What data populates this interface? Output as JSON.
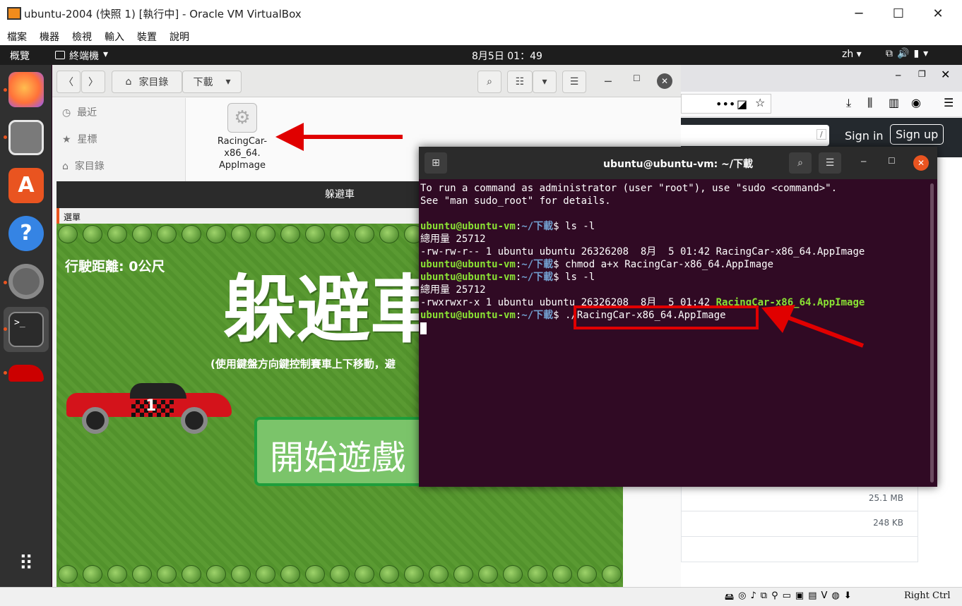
{
  "vbox": {
    "title": "ubuntu-2004 (快照 1) [執行中] - Oracle VM VirtualBox",
    "menu": [
      "檔案",
      "機器",
      "檢視",
      "輸入",
      "裝置",
      "說明"
    ],
    "status_right": "Right Ctrl"
  },
  "topbar": {
    "activities": "概覽",
    "app": "終端機",
    "clock": "8月5日  01：49",
    "lang": "zh"
  },
  "nautilus": {
    "path_home": "家目錄",
    "path_current": "下載",
    "sidebar": [
      "最近",
      "星標",
      "家目錄"
    ],
    "file_name": "RacingCar-x86_64.AppImage",
    "file_label_lines": [
      "RacingCar-",
      "x86_64.",
      "AppImage"
    ],
    "sizes": [
      "25.1 MB",
      "248 KB"
    ]
  },
  "firefox": {
    "sign_in": "Sign in",
    "sign_up": "Sign up"
  },
  "game": {
    "window_title": "躲避車",
    "menu_label": "選單",
    "distance": "行駛距離: 0公尺",
    "big_title": "躲避車",
    "subtitle": "(使用鍵盤方向鍵控制賽車上下移動，避",
    "start_button": "開始遊戲",
    "car_text": "1"
  },
  "terminal": {
    "title": "ubuntu@ubuntu-vm: ~/下載",
    "lines": [
      {
        "type": "text",
        "text": "To run a command as administrator (user \"root\"), use \"sudo <command>\"."
      },
      {
        "type": "text",
        "text": "See \"man sudo_root\" for details."
      },
      {
        "type": "text",
        "text": ""
      },
      {
        "type": "prompt",
        "user": "ubuntu@ubuntu-vm",
        "path": "~/下載",
        "cmd": "ls -l"
      },
      {
        "type": "text",
        "text": "總用量 25712"
      },
      {
        "type": "text",
        "text": "-rw-rw-r-- 1 ubuntu ubuntu 26326208  8月  5 01:42 RacingCar-x86_64.AppImage"
      },
      {
        "type": "prompt",
        "user": "ubuntu@ubuntu-vm",
        "path": "~/下載",
        "cmd": "chmod a+x RacingCar-x86_64.AppImage"
      },
      {
        "type": "prompt",
        "user": "ubuntu@ubuntu-vm",
        "path": "~/下載",
        "cmd": "ls -l"
      },
      {
        "type": "text",
        "text": "總用量 25712"
      },
      {
        "type": "exec",
        "text": "-rwxrwxr-x 1 ubuntu ubuntu 26326208  8月  5 01:42 ",
        "file": "RacingCar-x86_64.AppImage"
      },
      {
        "type": "prompt",
        "user": "ubuntu@ubuntu-vm",
        "path": "~/下載",
        "cmd": "./RacingCar-x86_64.AppImage"
      }
    ]
  },
  "colors": {
    "ubuntu_orange": "#e95420",
    "terminal_bg": "#300a24",
    "highlight_red": "#e00000",
    "prompt_green": "#8ae234",
    "prompt_blue": "#729fcf"
  }
}
